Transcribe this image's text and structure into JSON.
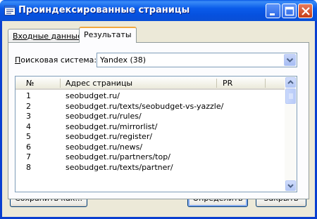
{
  "window": {
    "title": "Проиндексированные страницы",
    "title_icon": "list-window-icon",
    "controls": [
      "minimize-icon",
      "maximize-icon",
      "close-icon"
    ]
  },
  "tabs": [
    {
      "label": "Входные данные",
      "active": false
    },
    {
      "label": "Результаты",
      "active": true
    }
  ],
  "engine": {
    "label": "Поисковая система:",
    "selected": "Yandex (38)"
  },
  "table": {
    "columns": [
      "№",
      "Адрес страницы",
      "PR"
    ],
    "rows": [
      {
        "num": "1",
        "url": "seobudget.ru/"
      },
      {
        "num": "2",
        "url": "seobudget.ru/texts/seobudget-vs-yazzle/"
      },
      {
        "num": "3",
        "url": "seobudget.ru/rules/"
      },
      {
        "num": "4",
        "url": "seobudget.ru/mirrorlist/"
      },
      {
        "num": "5",
        "url": "seobudget.ru/register/"
      },
      {
        "num": "6",
        "url": "seobudget.ru/news/"
      },
      {
        "num": "7",
        "url": "seobudget.ru/partners/top/"
      },
      {
        "num": "8",
        "url": "seobudget.ru/texts/partner/"
      }
    ]
  },
  "buttons": {
    "save": "Сохранить как...",
    "define": "Определить",
    "close": "Закрыть"
  },
  "colors": {
    "title_bar": "#0a5bea",
    "client": "#ece9d8",
    "active_tab_accent": "#f2a83c",
    "close_button": "#c53d16"
  }
}
